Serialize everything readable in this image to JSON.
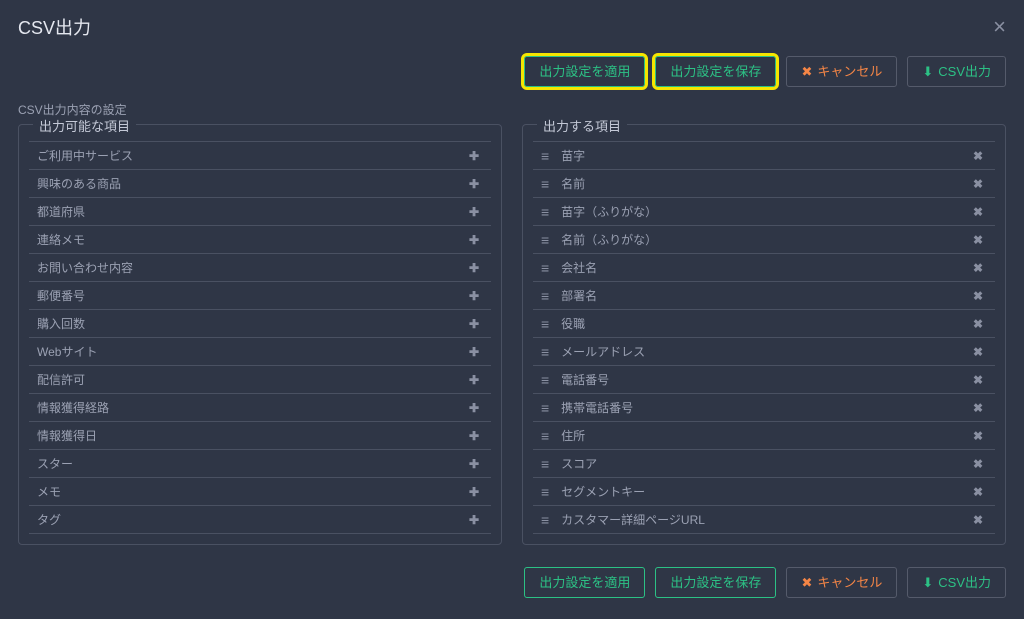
{
  "modal": {
    "title": "CSV出力",
    "close_label": "×"
  },
  "actions": {
    "apply": "出力設定を適用",
    "save": "出力設定を保存",
    "cancel": "キャンセル",
    "export": "CSV出力",
    "cancel_icon": "✖",
    "export_icon": "⬇"
  },
  "section_label": "CSV出力内容の設定",
  "available": {
    "legend": "出力可能な項目",
    "items": [
      "ご利用中サービス",
      "興味のある商品",
      "都道府県",
      "連絡メモ",
      "お問い合わせ内容",
      "郵便番号",
      "購入回数",
      "Webサイト",
      "配信許可",
      "情報獲得経路",
      "情報獲得日",
      "スター",
      "メモ",
      "タグ"
    ]
  },
  "selected": {
    "legend": "出力する項目",
    "items": [
      "苗字",
      "名前",
      "苗字（ふりがな）",
      "名前（ふりがな）",
      "会社名",
      "部署名",
      "役職",
      "メールアドレス",
      "電話番号",
      "携帯電話番号",
      "住所",
      "スコア",
      "セグメントキー",
      "カスタマー詳細ページURL"
    ]
  }
}
